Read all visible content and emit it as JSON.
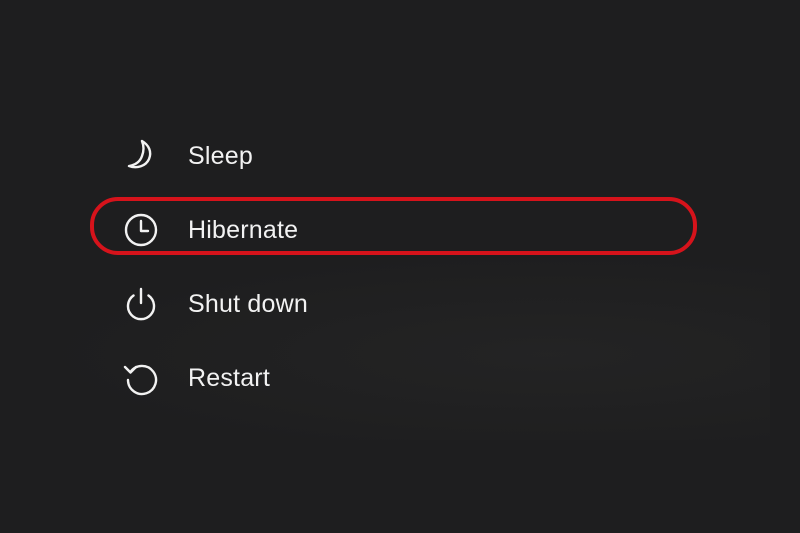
{
  "menu": {
    "items": [
      {
        "id": "sleep",
        "label": "Sleep",
        "icon": "moon-icon"
      },
      {
        "id": "hibernate",
        "label": "Hibernate",
        "icon": "clock-icon"
      },
      {
        "id": "shutdown",
        "label": "Shut down",
        "icon": "power-icon"
      },
      {
        "id": "restart",
        "label": "Restart",
        "icon": "restart-icon"
      }
    ],
    "highlighted_item": "hibernate"
  },
  "colors": {
    "background": "#1e1e1f",
    "text": "#f2f2f2",
    "icon_stroke": "#f2f2f2",
    "highlight_ring": "#d6131b"
  }
}
